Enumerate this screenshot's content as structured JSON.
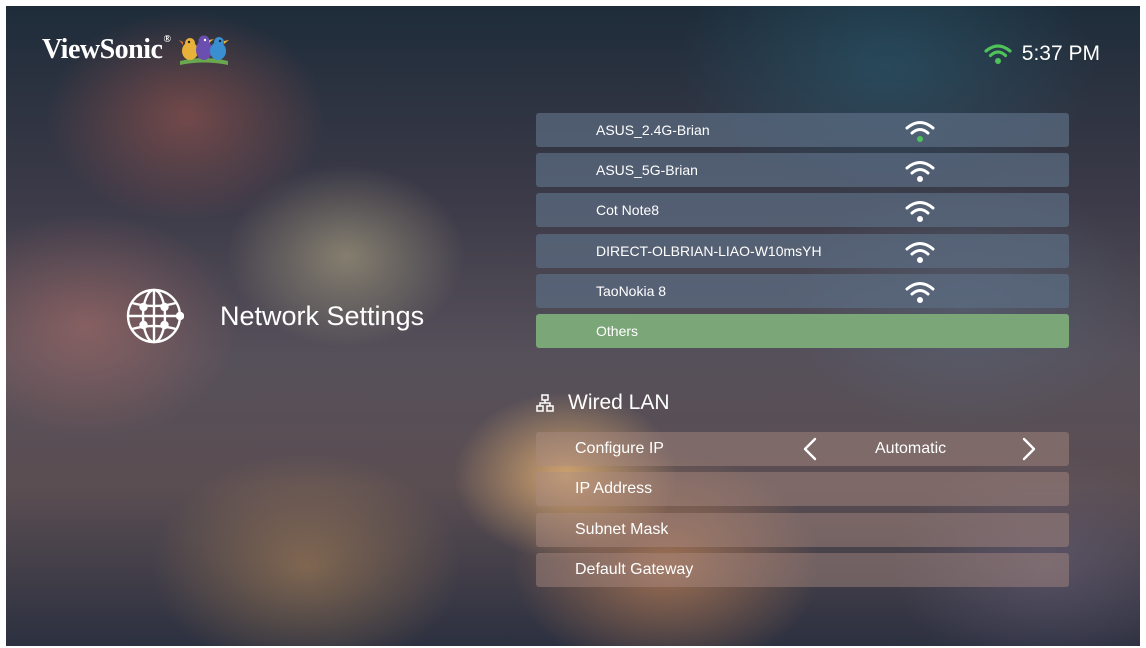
{
  "brand": {
    "logo_text": "ViewSonic",
    "registered_mark": "®",
    "logo_icon": "three-birds-logo"
  },
  "status_bar": {
    "wifi_icon": "wifi-icon",
    "wifi_color": "#4fc35a",
    "time": "5:37 PM"
  },
  "page": {
    "title": "Network Settings",
    "icon": "globe-icon"
  },
  "wifi_networks": [
    {
      "name": "ASUS_2.4G-Brian",
      "icon": "wifi-signal-icon"
    },
    {
      "name": "ASUS_5G-Brian",
      "icon": "wifi-signal-icon"
    },
    {
      "name": "Cot Note8",
      "icon": "wifi-signal-icon"
    },
    {
      "name": "DIRECT-OLBRIAN-LIAO-W10msYH",
      "icon": "wifi-signal-icon"
    },
    {
      "name": "TaoNokia 8",
      "icon": "wifi-signal-icon"
    }
  ],
  "others": {
    "label": "Others",
    "highlight_color": "#7ba677"
  },
  "wired_lan": {
    "title": "Wired LAN",
    "icon": "network-lan-icon",
    "configure_ip": {
      "label": "Configure IP",
      "value": "Automatic"
    },
    "ip_address": {
      "label": "IP Address"
    },
    "subnet_mask": {
      "label": "Subnet Mask"
    },
    "default_gateway": {
      "label": "Default Gateway"
    }
  }
}
